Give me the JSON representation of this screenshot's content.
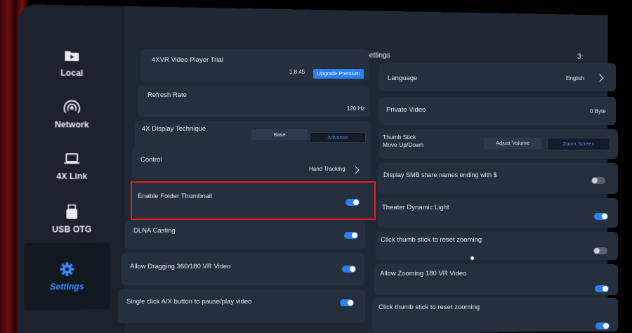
{
  "sidebar": {
    "items": [
      {
        "label": "Local",
        "icon": "play-folder-icon",
        "active": false
      },
      {
        "label": "Network",
        "icon": "network-icon",
        "active": false
      },
      {
        "label": "4X Link",
        "icon": "laptop-icon",
        "active": false
      },
      {
        "label": "USB OTG",
        "icon": "usb-drive-icon",
        "active": false
      },
      {
        "label": "Settings",
        "icon": "gear-icon",
        "active": true
      }
    ]
  },
  "header": {
    "title": "Settings",
    "clock": "3:"
  },
  "left_column": {
    "trial": {
      "label": "4XVR Video Player Trial",
      "version": "1.8.45",
      "button": "Upgrade Premium"
    },
    "refresh": {
      "label": "Refresh Rate",
      "value": "120 Hz"
    },
    "display": {
      "label": "4X Display Technique",
      "options": [
        "Base",
        "Advance"
      ],
      "selected": "Advance"
    },
    "control": {
      "label": "Control",
      "value": "Hand Tracking"
    },
    "folder_thumb": {
      "label": "Enable Folder Thumbnail",
      "on": true
    },
    "dlna": {
      "label": "DLNA Casting",
      "on": true
    },
    "dragging": {
      "label": "Allow Dragging 360/180 VR Video",
      "on": true
    },
    "single_click": {
      "label": "Single click A/X button to pause/play video",
      "on": true
    }
  },
  "right_column": {
    "language": {
      "label": "Language",
      "value": "English"
    },
    "private": {
      "label": "Private Video",
      "value": "0 Byte"
    },
    "thumb_stick": {
      "label_line1": "Thumb Stick",
      "label_line2": "Move Up/Down",
      "options": [
        "Adjust Volume",
        "Zoom Screen"
      ],
      "selected": "Zoom Screen"
    },
    "smb": {
      "label": "Display SMB share names ending with $",
      "on": false
    },
    "theater": {
      "label": "Theater Dynamic Light",
      "on": true
    },
    "reset_zoom_1": {
      "label": "Click thumb stick to reset zooming",
      "on": false
    },
    "zoom180": {
      "label": "Allow Zooming 180 VR Video",
      "on": true
    },
    "reset_zoom_2": {
      "label": "Click thumb stick to reset zooming",
      "on": true
    }
  },
  "colors": {
    "accent": "#2d7ff0",
    "highlight": "#e0231d",
    "panel": "#1d2430"
  }
}
